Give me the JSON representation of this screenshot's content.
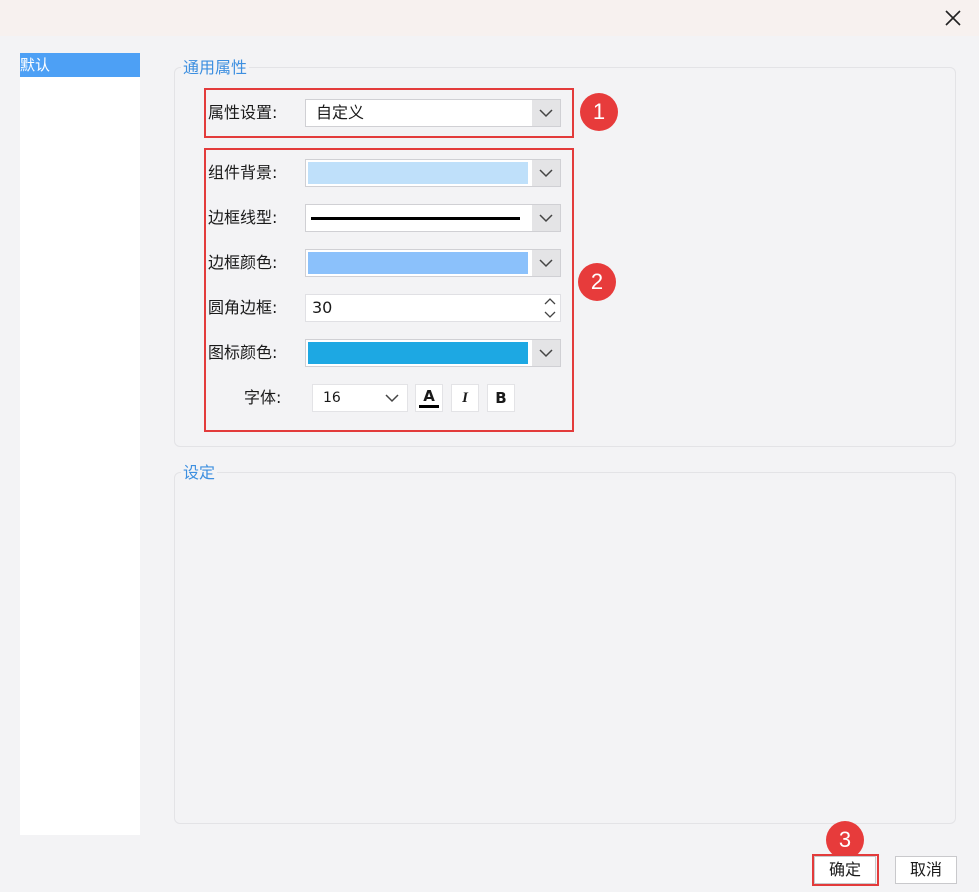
{
  "sidebar": {
    "items": [
      {
        "label": "默认"
      }
    ]
  },
  "general": {
    "legend": "通用属性",
    "property_setting": {
      "label": "属性设置:",
      "value": "自定义"
    },
    "component_bg": {
      "label": "组件背景:",
      "color": "#bfe0fa"
    },
    "border_style": {
      "label": "边框线型:"
    },
    "border_color": {
      "label": "边框颜色:",
      "color": "#8bc1fb"
    },
    "corner_radius": {
      "label": "圆角边框:",
      "value": "30"
    },
    "icon_color": {
      "label": "图标颜色:",
      "color": "#1da8e3"
    },
    "font": {
      "label": "字体:",
      "size": "16",
      "color_btn": "A",
      "italic_btn": "I",
      "bold_btn": "B"
    }
  },
  "settings": {
    "legend": "设定"
  },
  "badges": {
    "one": "1",
    "two": "2",
    "three": "3"
  },
  "footer": {
    "ok_label": "确定",
    "cancel_label": "取消"
  },
  "colors": {
    "accent": "#3d8fe0",
    "selection": "#4da0f5",
    "annotation": "#e33b3b"
  }
}
